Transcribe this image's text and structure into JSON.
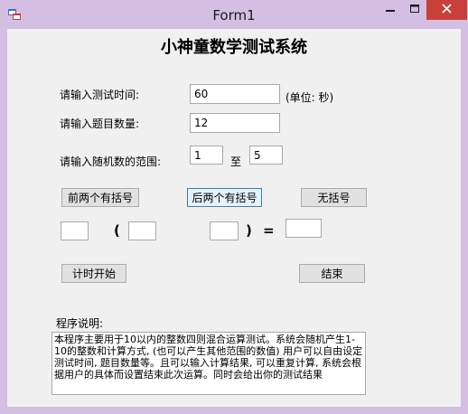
{
  "window": {
    "title": "Form1",
    "icons": {
      "app": "app-icon",
      "minimize": "minimize-icon",
      "maximize": "maximize-icon",
      "close": "close-icon"
    }
  },
  "form": {
    "heading": "小神童数学测试系统",
    "time_label": "请输入测试时间:",
    "time_value": "60",
    "unit_label": "(单位: 秒)",
    "count_label": "请输入题目数量:",
    "count_value": "12",
    "range_label": "请输入随机数的范围:",
    "range_from": "1",
    "range_to_label": "至",
    "range_to": "5",
    "btn_front_brackets": "前两个有括号",
    "btn_back_brackets": "后两个有括号",
    "btn_no_brackets": "无括号",
    "open_paren": "(",
    "close_paren": ")",
    "equals": "=",
    "operand1": "",
    "operand2": "",
    "operand3": "",
    "result": "",
    "btn_start": "计时开始",
    "btn_end": "结束",
    "desc_label": "程序说明:",
    "description": "本程序主要用于10以内的整数四则混合运算测试。系统会随机产生1-10的整数和计算方式, (也可以产生其他范围的数值) 用户可以自由设定测试时间, 题目数量等。且可以输入计算结果, 可以重复计算, 系统会根据用户的具体而设置结束此次运算。同时会给出你的测试结果"
  }
}
